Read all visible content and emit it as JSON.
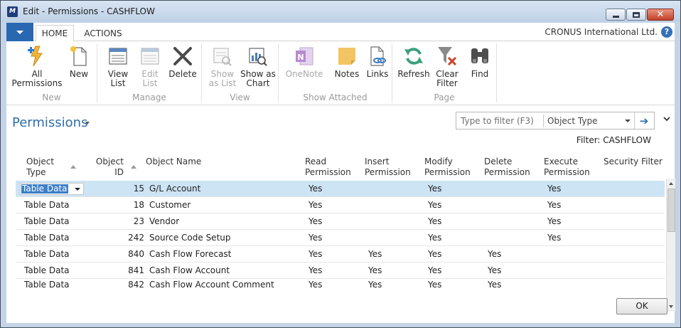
{
  "window": {
    "title": "Edit - Permissions - CASHFLOW",
    "app_icon": "dynamics-nav-logo-icon"
  },
  "tabs": [
    {
      "label": "HOME",
      "active": true
    },
    {
      "label": "ACTIONS",
      "active": false
    }
  ],
  "company": "CRONUS International Ltd.",
  "ribbon": {
    "groups": [
      {
        "label": "New",
        "buttons": [
          {
            "label": "All\nPermissions",
            "icon": "all-permissions-icon",
            "enabled": true
          },
          {
            "label": "New",
            "icon": "new-document-icon",
            "enabled": true
          }
        ]
      },
      {
        "label": "Manage",
        "buttons": [
          {
            "label": "View\nList",
            "icon": "view-list-icon",
            "enabled": true
          },
          {
            "label": "Edit\nList",
            "icon": "edit-list-icon",
            "enabled": false
          },
          {
            "label": "Delete",
            "icon": "delete-x-icon",
            "enabled": true
          }
        ]
      },
      {
        "label": "View",
        "buttons": [
          {
            "label": "Show\nas List",
            "icon": "show-as-list-icon",
            "enabled": false
          },
          {
            "label": "Show as\nChart",
            "icon": "show-as-chart-icon",
            "enabled": true
          }
        ]
      },
      {
        "label": "Show Attached",
        "buttons": [
          {
            "label": "OneNote",
            "icon": "onenote-icon",
            "enabled": false
          },
          {
            "label": "Notes",
            "icon": "notes-icon",
            "enabled": true
          },
          {
            "label": "Links",
            "icon": "links-icon",
            "enabled": true
          }
        ]
      },
      {
        "label": "Page",
        "buttons": [
          {
            "label": "Refresh",
            "icon": "refresh-icon",
            "enabled": true
          },
          {
            "label": "Clear\nFilter",
            "icon": "clear-filter-icon",
            "enabled": true
          },
          {
            "label": "Find",
            "icon": "binoculars-icon",
            "enabled": true
          }
        ]
      }
    ]
  },
  "page": {
    "title": "Permissions",
    "filter_placeholder": "Type to filter (F3)",
    "filter_field": "Object Type",
    "filter_status": "Filter: CASHFLOW"
  },
  "table": {
    "columns": [
      {
        "label": "Object\nType",
        "sorted": true
      },
      {
        "label": "Object\nID",
        "sorted": true
      },
      {
        "label": "Object Name",
        "sorted": false
      },
      {
        "label": "Read\nPermission",
        "sorted": false
      },
      {
        "label": "Insert\nPermission",
        "sorted": false
      },
      {
        "label": "Modify\nPermission",
        "sorted": false
      },
      {
        "label": "Delete\nPermission",
        "sorted": false
      },
      {
        "label": "Execute\nPermission",
        "sorted": false
      },
      {
        "label": "Security Filter",
        "sorted": false
      }
    ],
    "rows": [
      {
        "type": "Table Data",
        "id": "15",
        "name": "G/L Account",
        "read": "Yes",
        "insert": "",
        "modify": "Yes",
        "delete": "",
        "execute": "Yes",
        "filter": "",
        "selected": true
      },
      {
        "type": "Table Data",
        "id": "18",
        "name": "Customer",
        "read": "Yes",
        "insert": "",
        "modify": "Yes",
        "delete": "",
        "execute": "Yes",
        "filter": "",
        "selected": false
      },
      {
        "type": "Table Data",
        "id": "23",
        "name": "Vendor",
        "read": "Yes",
        "insert": "",
        "modify": "Yes",
        "delete": "",
        "execute": "Yes",
        "filter": "",
        "selected": false
      },
      {
        "type": "Table Data",
        "id": "242",
        "name": "Source Code Setup",
        "read": "Yes",
        "insert": "",
        "modify": "Yes",
        "delete": "",
        "execute": "Yes",
        "filter": "",
        "selected": false
      },
      {
        "type": "Table Data",
        "id": "840",
        "name": "Cash Flow Forecast",
        "read": "Yes",
        "insert": "Yes",
        "modify": "Yes",
        "delete": "Yes",
        "execute": "",
        "filter": "",
        "selected": false
      },
      {
        "type": "Table Data",
        "id": "841",
        "name": "Cash Flow Account",
        "read": "Yes",
        "insert": "Yes",
        "modify": "Yes",
        "delete": "Yes",
        "execute": "",
        "filter": "",
        "selected": false
      },
      {
        "type": "Table Data",
        "id": "842",
        "name": "Cash Flow Account Comment",
        "read": "Yes",
        "insert": "Yes",
        "modify": "Yes",
        "delete": "Yes",
        "execute": "",
        "filter": "",
        "selected": false
      }
    ]
  },
  "ok_label": "OK",
  "colors": {
    "accent": "#2f6ea8",
    "selected_row": "#cde4f5",
    "app_menu": "#2a67b1"
  }
}
